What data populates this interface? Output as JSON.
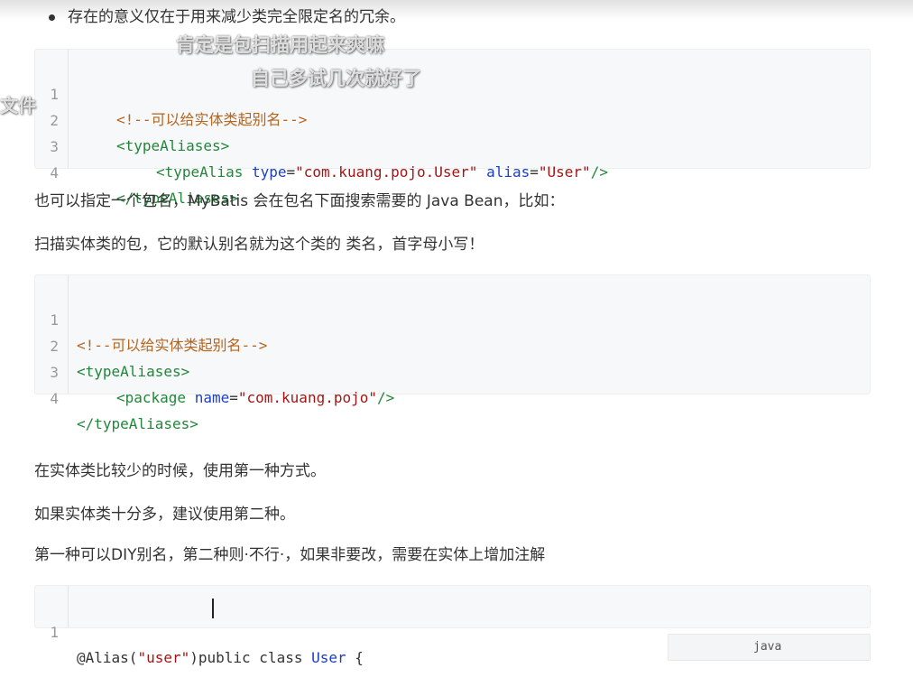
{
  "bullet_text": "存在的意义仅在于用来减少类完全限定名的冗余。",
  "overlay": {
    "subtitle_line1": "肯定是包扫描用起来爽嘛",
    "subtitle_line2": "自己多试几次就好了",
    "side_fragment": "文件"
  },
  "code_block_1": {
    "lines": [
      {
        "num": "1",
        "comment": "<!--可以给实体类起别名-->"
      },
      {
        "num": "2",
        "tag_open": "<typeAliases>"
      },
      {
        "num": "3",
        "tag_start": "<typeAlias",
        "attr1": "type",
        "eq1": "=",
        "val1": "\"com.kuang.pojo.User\"",
        "attr2": "alias",
        "eq2": "=",
        "val2": "\"User\"",
        "tag_end": "/>"
      },
      {
        "num": "4",
        "tag_close": "</typeAliases>"
      }
    ]
  },
  "para_1": "也可以指定一个包名，MyBatis 会在包名下面搜索需要的 Java Bean，比如：",
  "para_2": "扫描实体类的包，它的默认别名就为这个类的 类名，首字母小写！",
  "code_block_2": {
    "lines": [
      {
        "num": "1",
        "comment": "<!--可以给实体类起别名-->"
      },
      {
        "num": "2",
        "tag_open": "<typeAliases>"
      },
      {
        "num": "3",
        "tag_start": "<package",
        "attr1": "name",
        "eq1": "=",
        "val1": "\"com.kuang.pojo\"",
        "tag_end": "/>"
      },
      {
        "num": "4",
        "tag_close": "</typeAliases>"
      }
    ]
  },
  "para_3": "在实体类比较少的时候，使用第一种方式。",
  "para_4": "如果实体类十分多，建议使用第二种。",
  "para_5": "第一种可以DIY别名，第二种则·不行·，如果非要改，需要在实体上增加注解",
  "code_block_3": {
    "lines": [
      {
        "num": "1",
        "anno": "@Alias(",
        "str": "\"user\"",
        "anno_end": ")",
        "kw": "public class ",
        "type": "User",
        "rest": " {"
      }
    ]
  },
  "language_label": "java"
}
